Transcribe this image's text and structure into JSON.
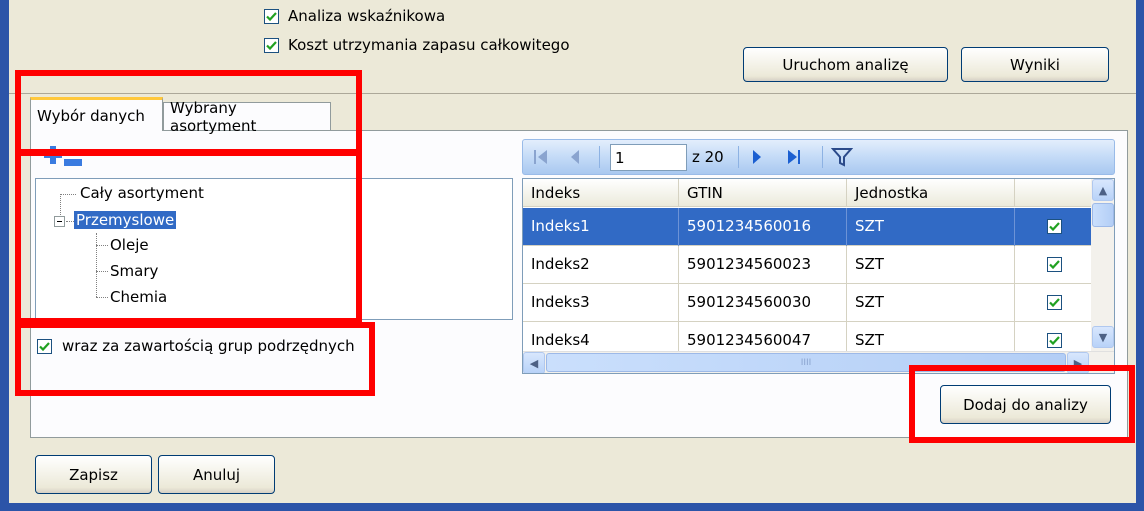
{
  "options": {
    "ratio_analysis": {
      "label": "Analiza wskaźnikowa",
      "checked": true
    },
    "total_cost": {
      "label": "Koszt utrzymania zapasu całkowitego",
      "checked": true
    }
  },
  "buttons": {
    "run_analysis": "Uruchom analizę",
    "results": "Wyniki",
    "add_to_analysis": "Dodaj do analizy",
    "save": "Zapisz",
    "cancel": "Anuluj"
  },
  "tabs": [
    {
      "label": "Wybór danych",
      "active": true
    },
    {
      "label": "Wybrany asortyment",
      "active": false
    }
  ],
  "tree": {
    "items": [
      {
        "label": "Cały asortyment",
        "level": 0,
        "selected": false
      },
      {
        "label": "Przemyslowe",
        "level": 0,
        "selected": true,
        "expanded": true
      },
      {
        "label": "Oleje",
        "level": 1,
        "selected": false
      },
      {
        "label": "Smary",
        "level": 1,
        "selected": false
      },
      {
        "label": "Chemia",
        "level": 1,
        "selected": false
      }
    ]
  },
  "include_subgroups": {
    "label": "wraz za zawartością grup podrzędnych",
    "checked": true
  },
  "pager": {
    "current_page": "1",
    "total_label": "z 20"
  },
  "grid": {
    "columns": [
      "Indeks",
      "GTIN",
      "Jednostka",
      ""
    ],
    "rows": [
      {
        "indeks": "Indeks1",
        "gtin": "5901234560016",
        "unit": "SZT",
        "checked": true,
        "selected": true
      },
      {
        "indeks": "Indeks2",
        "gtin": "5901234560023",
        "unit": "SZT",
        "checked": true,
        "selected": false
      },
      {
        "indeks": "Indeks3",
        "gtin": "5901234560030",
        "unit": "SZT",
        "checked": true,
        "selected": false
      },
      {
        "indeks": "Indeks4",
        "gtin": "5901234560047",
        "unit": "SZT",
        "checked": true,
        "selected": false
      }
    ],
    "hscroll_grip": "IIII"
  },
  "colors": {
    "window_border": "#2c54a8",
    "dialog_bg": "#ece9d8",
    "selection": "#316ac5",
    "highlight_annotation": "#ff0000",
    "checkmark": "#21a121"
  },
  "icons": {
    "expand_all": "plus-icon",
    "collapse_all": "minus-icon",
    "first_page": "first-page-icon",
    "prev_page": "prev-page-icon",
    "next_page": "next-page-icon",
    "last_page": "last-page-icon",
    "filter": "filter-icon",
    "tree_toggle": "tree-collapse-icon"
  }
}
